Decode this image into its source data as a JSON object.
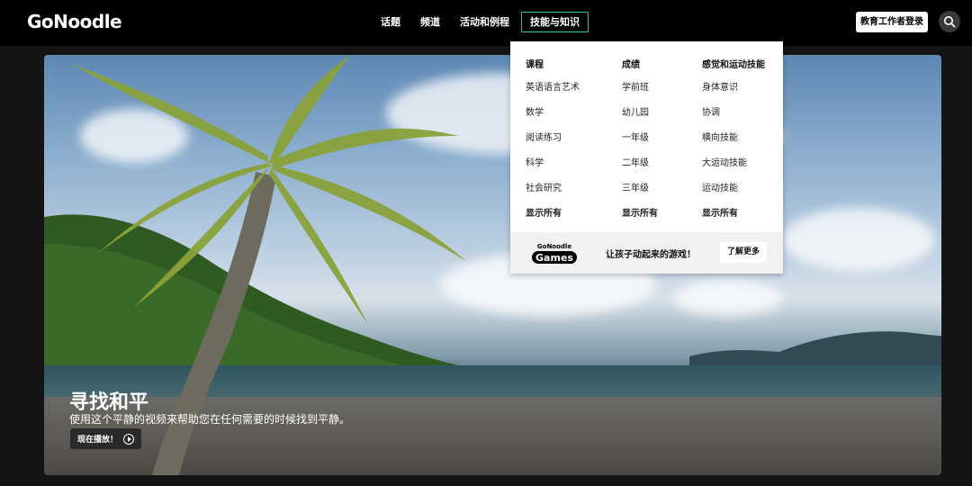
{
  "header": {
    "logo": "GoNoodle",
    "nav": [
      "话题",
      "频道",
      "活动和例程",
      "技能与知识"
    ],
    "login_label": "教育工作者登录",
    "search_icon": "search-icon"
  },
  "dropdown": {
    "columns": [
      {
        "heading": "课程",
        "links": [
          "英语语言艺术",
          "数学",
          "阅读练习",
          "科学",
          "社会研究"
        ],
        "show_all": "显示所有"
      },
      {
        "heading": "成绩",
        "links": [
          "学前班",
          "幼儿园",
          "一年级",
          "二年级",
          "三年级"
        ],
        "show_all": "显示所有"
      },
      {
        "heading": "感觉和运动技能",
        "links": [
          "身体意识",
          "协调",
          "横向技能",
          "大运动技能",
          "运动技能"
        ],
        "show_all": "显示所有"
      }
    ],
    "footer": {
      "logo_top": "GoNoodle",
      "logo_bottom": "Games",
      "text": "让孩子动起来的游戏！",
      "button": "了解更多"
    }
  },
  "hero": {
    "title": "寻找和平",
    "subtitle": "使用这个平静的视频来帮助您在任何需要的时候找到平静。",
    "play_label": "现在播放！",
    "play_icon": "play-circle-icon"
  },
  "colors": {
    "accent": "#3ccb8a",
    "topbar": "#000000"
  }
}
